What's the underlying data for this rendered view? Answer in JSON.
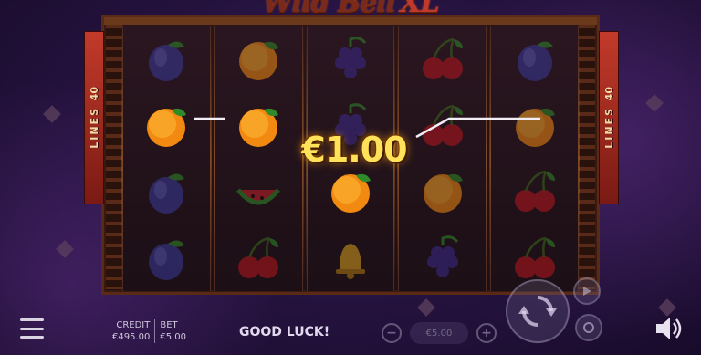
{
  "game": {
    "title_main": "Wild Bell",
    "title_suffix": "XL"
  },
  "paylines": {
    "count": "40",
    "label": "LINES"
  },
  "win": {
    "amount": "€1.00"
  },
  "reels": [
    [
      "plum",
      "orange",
      "plum",
      "plum"
    ],
    [
      "orange",
      "orange",
      "watermelon",
      "cherry"
    ],
    [
      "grapes",
      "grapes",
      "orange",
      "bell"
    ],
    [
      "cherry",
      "cherry",
      "orange",
      "grapes"
    ],
    [
      "plum",
      "orange",
      "cherry",
      "cherry"
    ]
  ],
  "winning_positions": [
    [
      0,
      1
    ],
    [
      1,
      1
    ],
    [
      2,
      2
    ]
  ],
  "footer": {
    "credit_label": "CREDIT",
    "credit_value": "€495.00",
    "bet_label": "BET",
    "bet_value": "€5.00",
    "status": "GOOD LUCK!",
    "stake_value": "€5.00",
    "minus": "−",
    "plus": "+"
  },
  "icons": {
    "menu": "hamburger-icon",
    "spin": "spin-arrows-icon",
    "autoplay": "autoplay-icon",
    "sound": "speaker-icon"
  },
  "colors": {
    "win_text": "#ffe15a",
    "lines_tab": "#c23a2a",
    "background": "#24123d"
  }
}
